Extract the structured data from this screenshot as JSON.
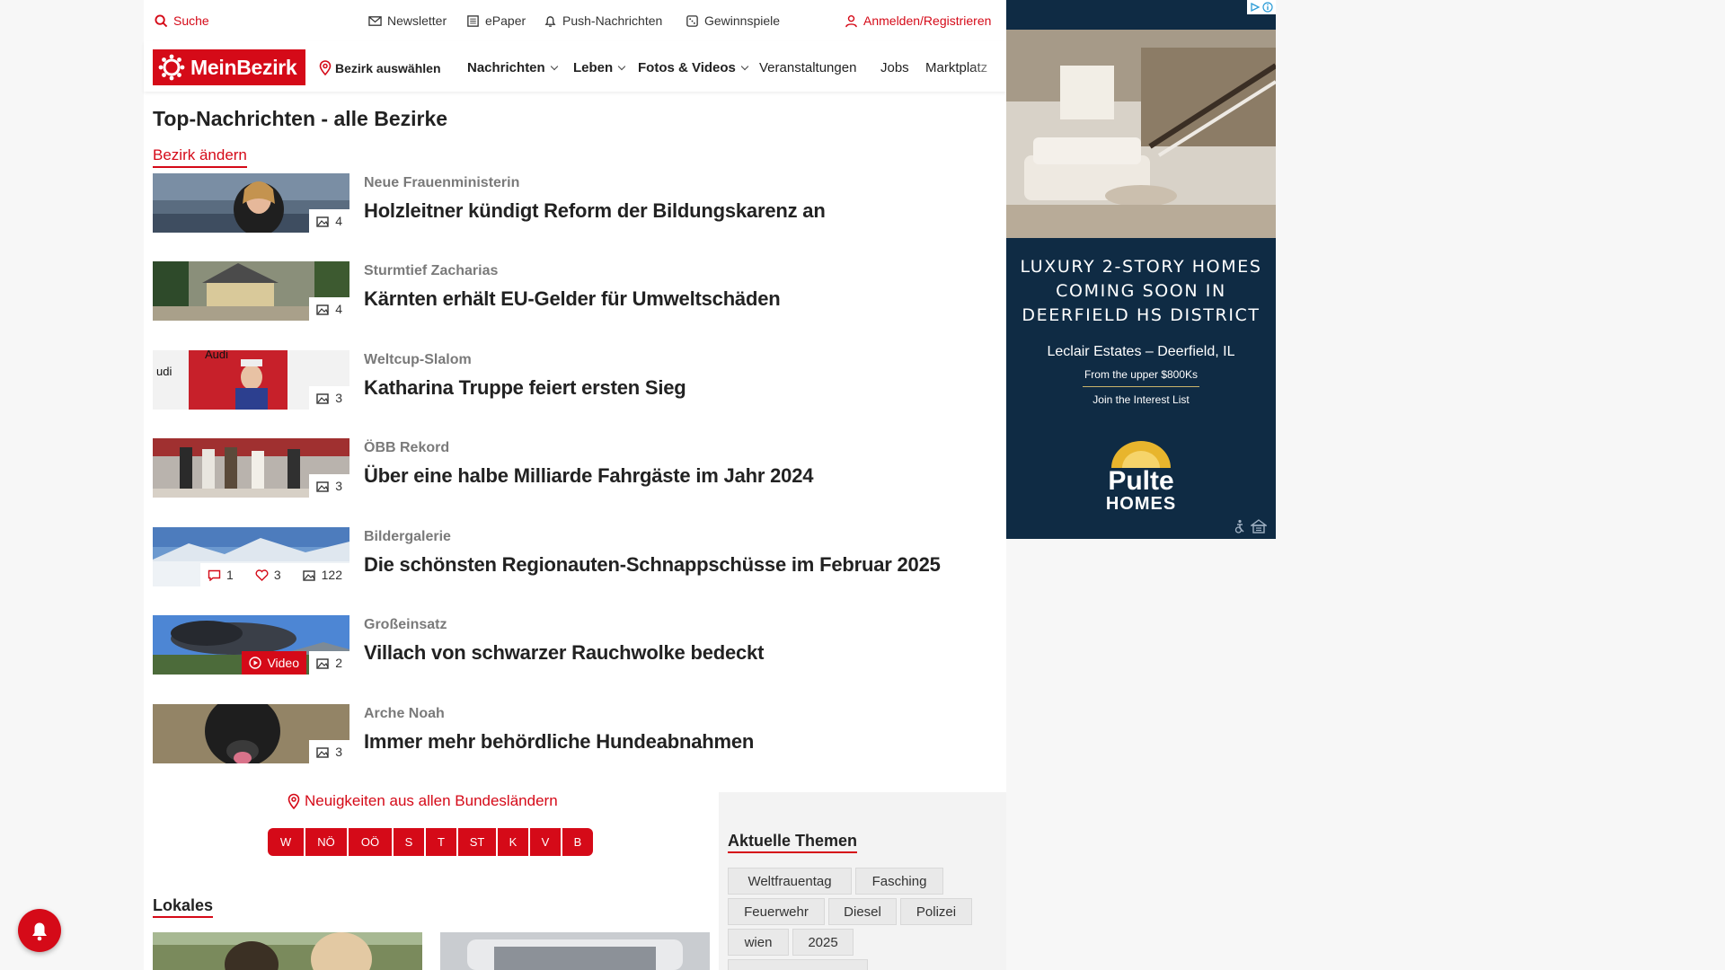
{
  "utility": {
    "search": "Suche",
    "newsletter": "Newsletter",
    "epaper": "ePaper",
    "push": "Push-Nachrichten",
    "games": "Gewinnspiele",
    "login": "Anmelden/Registrieren"
  },
  "nav": {
    "logo": "MeinBezirk",
    "district": "Bezirk auswählen",
    "items": [
      "Nachrichten",
      "Leben",
      "Fotos & Videos",
      "Veranstaltungen",
      "Jobs",
      "Marktplatz"
    ]
  },
  "main": {
    "title": "Top-Nachrichten - alle Bezirke",
    "change_district": "Bezirk ändern",
    "articles": [
      {
        "kicker": "Neue Frauenministerin",
        "headline": "Holzleitner kündigt Reform der Bildungskarenz an",
        "images": "4"
      },
      {
        "kicker": "Sturmtief Zacharias",
        "headline": "Kärnten erhält EU-Gelder für Umweltschäden",
        "images": "4"
      },
      {
        "kicker": "Weltcup-Slalom",
        "headline": "Katharina Truppe feiert ersten Sieg",
        "images": "3",
        "thumb_text1": "Audi",
        "thumb_text2": "udi"
      },
      {
        "kicker": "ÖBB Rekord",
        "headline": "Über eine halbe Milliarde Fahrgäste im Jahr 2024",
        "images": "3"
      },
      {
        "kicker": "Bildergalerie",
        "headline": "Die schönsten Regionauten-Schnappschüsse im Februar 2025",
        "comments": "1",
        "likes": "3",
        "images": "122"
      },
      {
        "kicker": "Großeinsatz",
        "headline": "Villach von schwarzer Rauchwolke bedeckt",
        "video": "Video",
        "images": "2"
      },
      {
        "kicker": "Arche Noah",
        "headline": "Immer mehr behördliche Hundeabnahmen",
        "images": "3"
      }
    ],
    "bundeslaender_link": "Neuigkeiten aus allen Bundesländern",
    "bundeslaender": [
      "W",
      "NÖ",
      "OÖ",
      "S",
      "T",
      "ST",
      "K",
      "V",
      "B"
    ],
    "lokales": "Lokales"
  },
  "themen": {
    "title": "Aktuelle Themen",
    "tags": [
      "Weltfrauentag",
      "Fasching",
      "Feuerwehr",
      "Diesel",
      "Polizei",
      "wien",
      "2025"
    ]
  },
  "ad": {
    "headline_lines": [
      "LUXURY 2-STORY HOMES",
      "COMING SOON IN",
      "DEERFIELD HS DISTRICT"
    ],
    "location": "Leclair Estates – Deerfield, IL",
    "price": "From the upper $800Ks",
    "cta": "Join the Interest List",
    "brand_top": "Pulte",
    "brand_bottom": "HOMES",
    "colors": {
      "background": "#0f2b44",
      "gold": "#c9b36b"
    }
  },
  "colors": {
    "accent": "#d50a18"
  }
}
